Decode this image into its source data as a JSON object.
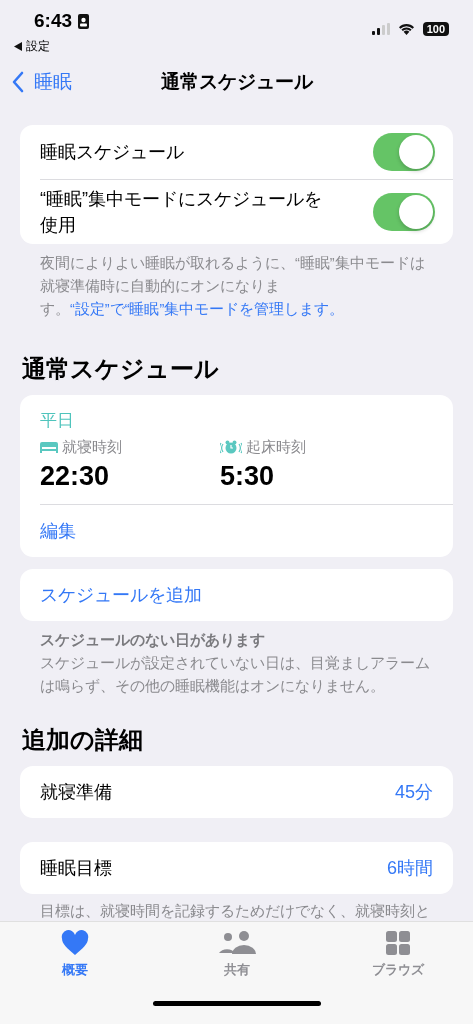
{
  "status_bar": {
    "time": "6:43",
    "back_app": "設定",
    "battery": "100"
  },
  "nav": {
    "back": "睡眠",
    "title": "通常スケジュール"
  },
  "toggles": [
    {
      "label": "睡眠スケジュール",
      "on": true
    },
    {
      "label": "“睡眠”集中モードにスケジュールを使用",
      "on": true
    }
  ],
  "toggle_note": {
    "text": "夜間によりよい睡眠が取れるように、“睡眠”集中モードは就寝準備時に自動的にオンになります。",
    "link": "“設定”で“睡眠”集中モードを管理します。"
  },
  "schedule_section": {
    "title": "通常スケジュール",
    "schedules": [
      {
        "days": "平日",
        "bedtime_label": "就寝時刻",
        "bedtime": "22:30",
        "wake_label": "起床時刻",
        "wake": "5:30",
        "edit": "編集"
      }
    ],
    "add_button": "スケジュールを追加",
    "note_title": "スケジュールのない日があります",
    "note_text": "スケジュールが設定されていない日は、目覚ましアラームは鳴らず、その他の睡眠機能はオンになりません。"
  },
  "details": {
    "title": "追加の詳細",
    "rows": [
      {
        "label": "就寝準備",
        "value": "45分"
      },
      {
        "label": "睡眠目標",
        "value": "6時間"
      }
    ],
    "footnote": "目標は、就寝時間を記録するためだけでなく、就寝時刻と"
  },
  "tab_bar": [
    {
      "kind": "heart",
      "label": "概要",
      "selected": true
    },
    {
      "kind": "people",
      "label": "共有",
      "selected": false
    },
    {
      "kind": "grid",
      "label": "ブラウズ",
      "selected": false
    }
  ]
}
